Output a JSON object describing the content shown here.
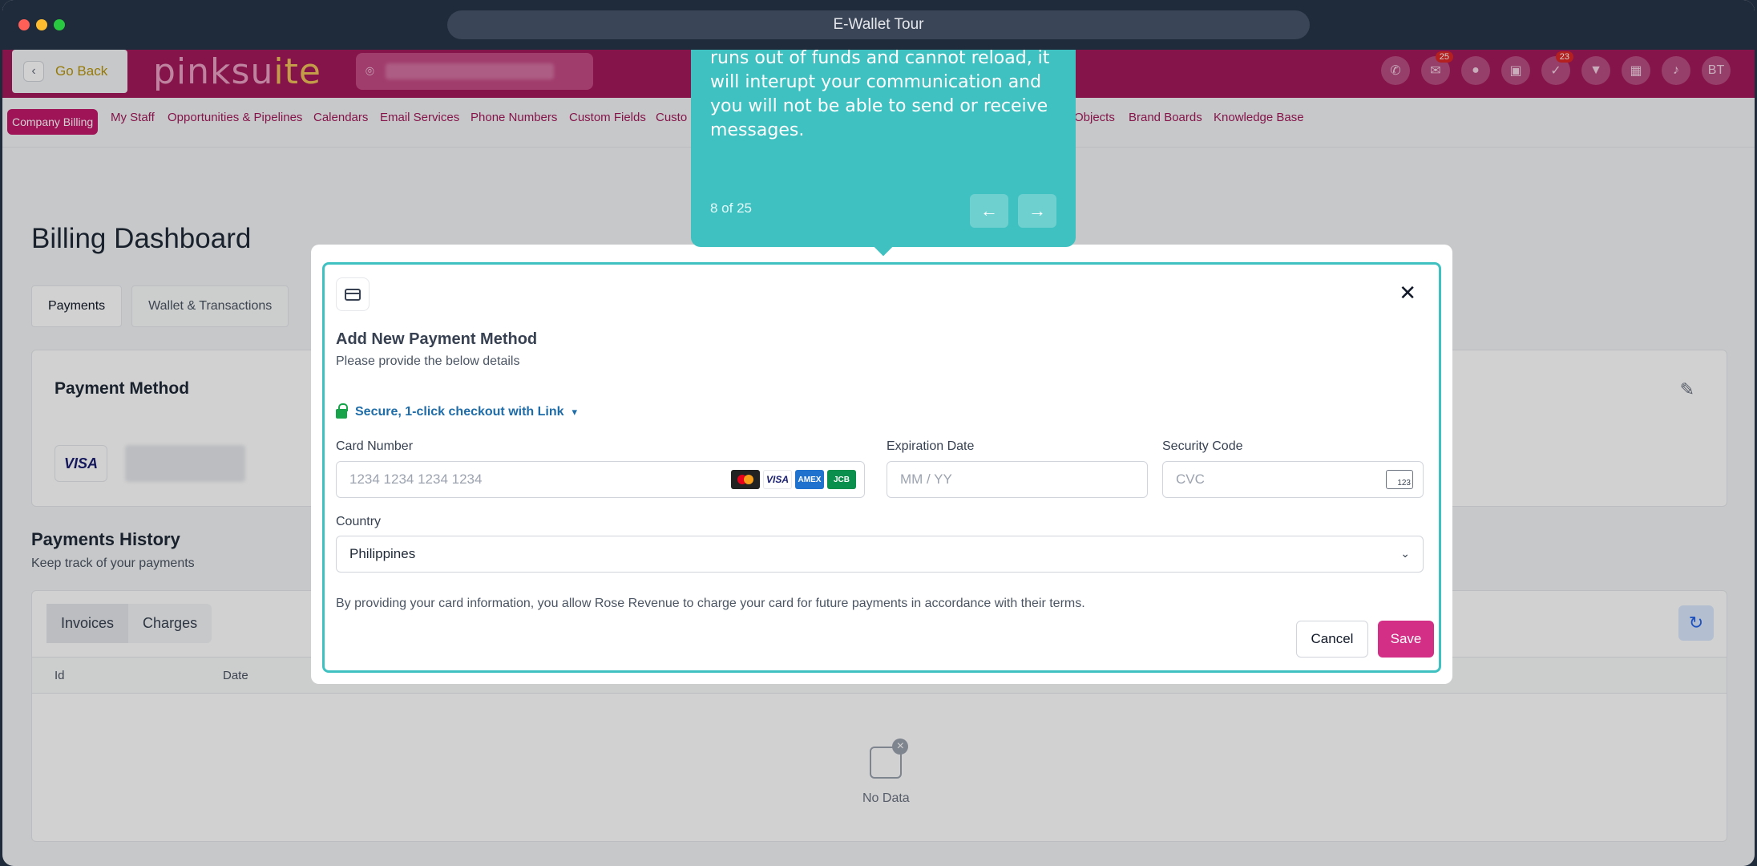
{
  "window": {
    "title": "E-Wallet Tour"
  },
  "header": {
    "go_back": "Go Back",
    "logo_main": "pinksu",
    "logo_accent": "ite",
    "badge_inbox": "25",
    "badge_tasks": "23",
    "avatar": "BT"
  },
  "nav": {
    "items": [
      "Company Billing",
      "My Staff",
      "Opportunities & Pipelines",
      "Calendars",
      "Email Services",
      "Phone Numbers",
      "Custom Fields",
      "Custo",
      "Objects",
      "Brand Boards",
      "Knowledge Base"
    ]
  },
  "page": {
    "title": "Billing Dashboard",
    "tabs": [
      "Payments",
      "Wallet & Transactions"
    ],
    "payment_method_title": "Payment Method",
    "visa_label": "VISA",
    "history_title": "Payments History",
    "history_sub": "Keep track of your payments",
    "history_tabs": [
      "Invoices",
      "Charges"
    ],
    "columns": [
      "Id",
      "Date"
    ],
    "no_data": "No Data"
  },
  "modal": {
    "title": "Add New Payment Method",
    "subtitle": "Please provide the below details",
    "link_label": "Secure, 1-click checkout with Link",
    "card_label": "Card Number",
    "card_placeholder": "1234 1234 1234 1234",
    "exp_label": "Expiration Date",
    "exp_placeholder": "MM / YY",
    "cvc_label": "Security Code",
    "cvc_placeholder": "CVC",
    "cvc_icon_text": "123",
    "country_label": "Country",
    "country_value": "Philippines",
    "brands": [
      "VISA",
      "AMEX",
      "JCB"
    ],
    "terms": "By providing your card information, you allow Rose Revenue to charge your card for future payments in accordance with their terms.",
    "cancel": "Cancel",
    "save": "Save"
  },
  "tour": {
    "text": "a credit card for this. If your e-wallet runs out of funds and cannot reload, it will interupt your communication and you will not be able to send or receive messages.",
    "step": "8 of 25"
  },
  "colors": {
    "brand": "#a3195b",
    "tour": "#3fc1c1",
    "save": "#d42f86"
  }
}
